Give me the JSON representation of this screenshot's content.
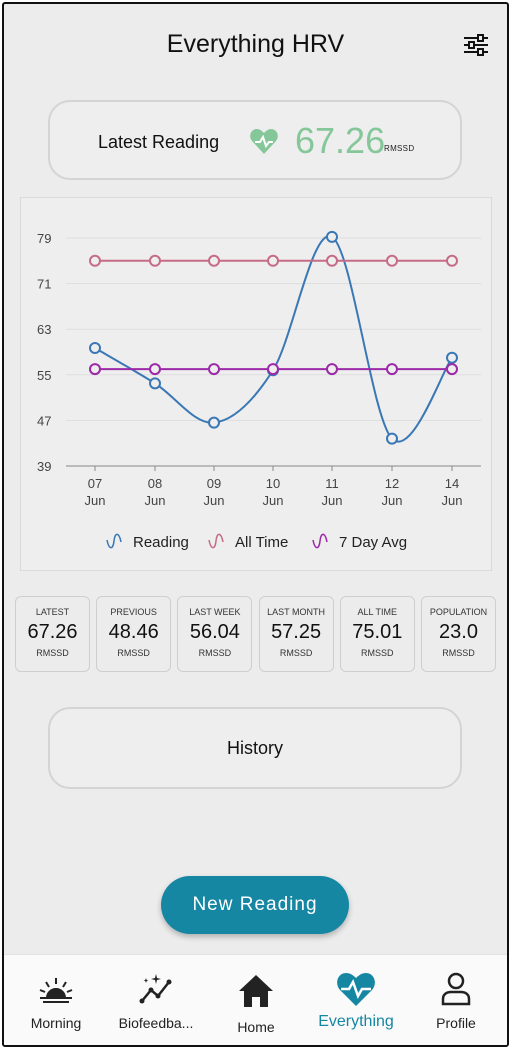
{
  "header": {
    "title": "Everything HRV",
    "settings_icon": "sliders-icon"
  },
  "latest_card": {
    "label": "Latest Reading",
    "value": "67.26",
    "unit": "RMSSD",
    "icon": "heart-pulse-icon",
    "value_color": "#86c79a"
  },
  "chart_data": {
    "type": "line",
    "categories": [
      "07 Jun",
      "08 Jun",
      "09 Jun",
      "10 Jun",
      "11 Jun",
      "12 Jun",
      "14 Jun"
    ],
    "x_ticks": [
      [
        "07",
        "Jun"
      ],
      [
        "08",
        "Jun"
      ],
      [
        "09",
        "Jun"
      ],
      [
        "10",
        "Jun"
      ],
      [
        "11",
        "Jun"
      ],
      [
        "12",
        "Jun"
      ],
      [
        "14",
        "Jun"
      ]
    ],
    "y_ticks": [
      "79",
      "71",
      "63",
      "55",
      "47",
      "39"
    ],
    "ylim": [
      39,
      79
    ],
    "grid": true,
    "legend_position": "bottom",
    "series": [
      {
        "name": "Reading",
        "color": "#3a78b5",
        "smooth": true,
        "values": [
          59.7,
          53.5,
          46.6,
          55.8,
          79.2,
          43.8,
          58.0
        ]
      },
      {
        "name": "All Time",
        "color": "#c56b86",
        "smooth": false,
        "values": [
          75.0,
          75.0,
          75.0,
          75.0,
          75.0,
          75.0,
          75.0
        ]
      },
      {
        "name": "7 Day Avg",
        "color": "#9c2aa8",
        "smooth": false,
        "values": [
          56.0,
          56.0,
          56.0,
          56.0,
          56.0,
          56.0,
          56.0
        ]
      }
    ]
  },
  "stats": [
    {
      "label": "LATEST",
      "value": "67.26",
      "unit": "RMSSD"
    },
    {
      "label": "PREVIOUS",
      "value": "48.46",
      "unit": "RMSSD"
    },
    {
      "label": "LAST WEEK",
      "value": "56.04",
      "unit": "RMSSD"
    },
    {
      "label": "LAST MONTH",
      "value": "57.25",
      "unit": "RMSSD"
    },
    {
      "label": "ALL TIME",
      "value": "75.01",
      "unit": "RMSSD"
    },
    {
      "label": "POPULATION",
      "value": "23.0",
      "unit": "RMSSD"
    }
  ],
  "history_button": {
    "label": "History"
  },
  "new_reading_button": {
    "label": "New Reading",
    "color": "#1587a3"
  },
  "tabs": [
    {
      "label": "Morning",
      "icon": "sunrise-icon",
      "active": false
    },
    {
      "label": "Biofeedba...",
      "icon": "sparkle-graph-icon",
      "active": false
    },
    {
      "label": "Home",
      "icon": "home-icon",
      "active": false
    },
    {
      "label": "Everything",
      "icon": "heart-pulse-icon",
      "active": true,
      "active_color": "#1587a3"
    },
    {
      "label": "Profile",
      "icon": "person-icon",
      "active": false
    }
  ]
}
